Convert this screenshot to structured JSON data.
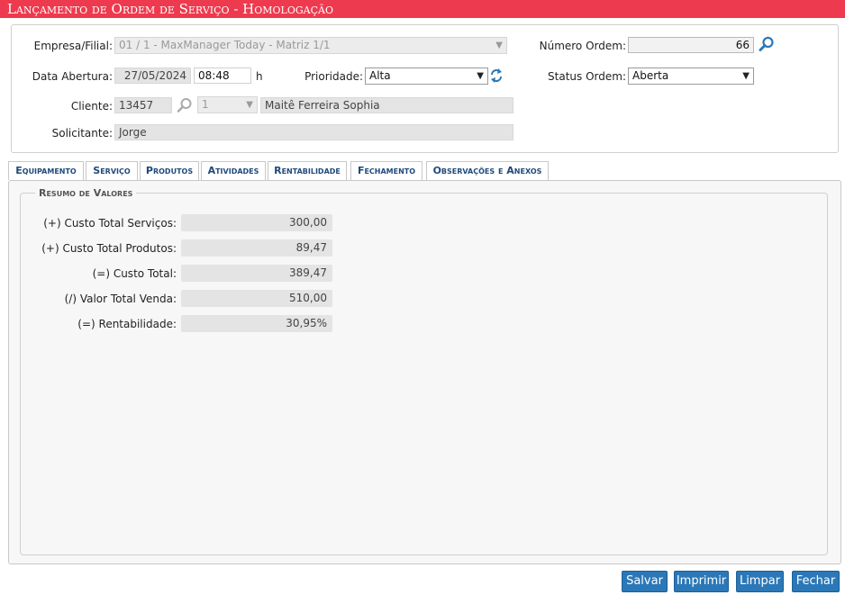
{
  "window": {
    "title": "Lançamento de Ordem de Serviço  - Homologação"
  },
  "header": {
    "empresa": {
      "label": "Empresa/Filial:",
      "value": "01 / 1 - MaxManager Today - Matriz 1/1"
    },
    "numero_ordem": {
      "label": "Número Ordem:",
      "value": "66",
      "icon": "search-icon"
    },
    "data_abertura": {
      "label": "Data Abertura:",
      "date": "27/05/2024",
      "time": "08:48",
      "unit": "h"
    },
    "prioridade": {
      "label": "Prioridade:",
      "value": "Alta",
      "icon": "refresh-icon"
    },
    "status_ordem": {
      "label": "Status Ordem:",
      "value": "Aberta"
    },
    "cliente": {
      "label": "Cliente:",
      "code": "13457",
      "seq": "1",
      "name": "Maitê Ferreira Sophia",
      "icon": "search-icon"
    },
    "solicitante": {
      "label": "Solicitante:",
      "value": "Jorge"
    }
  },
  "tabs": [
    {
      "label": "Equipamento"
    },
    {
      "label": "Serviço"
    },
    {
      "label": "Produtos"
    },
    {
      "label": "Atividades"
    },
    {
      "label": "Rentabilidade",
      "active": true
    },
    {
      "label": "Fechamento"
    },
    {
      "label": "Observações e Anexos"
    }
  ],
  "resumo": {
    "legend": "Resumo de Valores",
    "rows": [
      {
        "label": "(+) Custo Total Serviços:",
        "value": "300,00"
      },
      {
        "label": "(+) Custo Total Produtos:",
        "value": "89,47"
      },
      {
        "label": "(=) Custo Total:",
        "value": "389,47"
      },
      {
        "label": "(/) Valor Total Venda:",
        "value": "510,00"
      },
      {
        "label": "(=) Rentabilidade:",
        "value": "30,95%"
      }
    ]
  },
  "buttons": {
    "salvar": "Salvar",
    "imprimir": "Imprimir",
    "limpar": "Limpar",
    "fechar": "Fechar"
  },
  "colors": {
    "title_bar": "#ee3a4e",
    "accent": "#1f4a7a",
    "button": "#2b78b8"
  }
}
